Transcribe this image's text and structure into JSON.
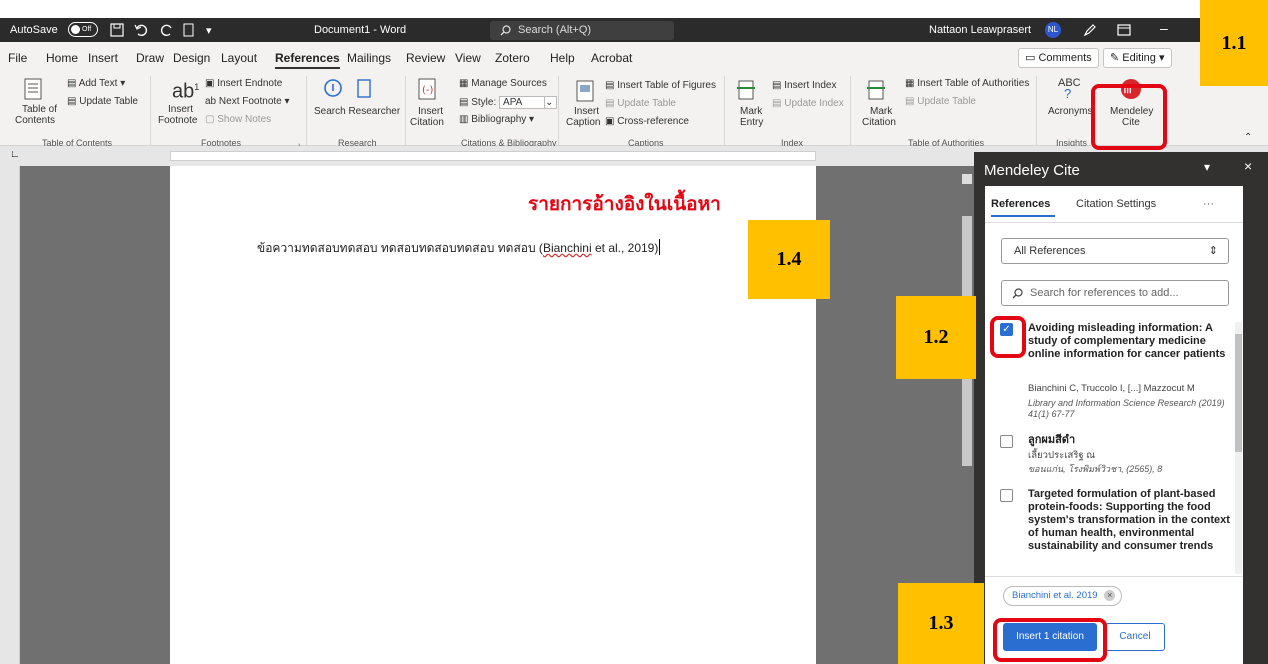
{
  "titlebar": {
    "autosave_label": "AutoSave",
    "autosave_state": "Off",
    "document_title": "Document1  -  Word",
    "search_placeholder": "Search (Alt+Q)",
    "user_name": "Nattaon Leawprasert",
    "user_initials": "NL"
  },
  "tabs": [
    "File",
    "Home",
    "Insert",
    "Draw",
    "Design",
    "Layout",
    "References",
    "Mailings",
    "Review",
    "View",
    "Zotero",
    "Help",
    "Acrobat"
  ],
  "active_tab": "References",
  "comments_label": "Comments",
  "editing_label": "Editing",
  "ribbon": {
    "toc": {
      "label1": "Table of",
      "label2": "Contents",
      "add_text": "Add Text",
      "update_table": "Update Table",
      "group": "Table of Contents"
    },
    "footnotes": {
      "label1": "Insert",
      "label2": "Footnote",
      "insert_endnote": "Insert Endnote",
      "next_footnote": "Next Footnote",
      "show_notes": "Show Notes",
      "group": "Footnotes"
    },
    "research": {
      "label": "Search Researcher",
      "group": "Research"
    },
    "citations": {
      "label1": "Insert",
      "label2": "Citation",
      "manage_sources": "Manage Sources",
      "style_label": "Style:",
      "style_value": "APA",
      "bibliography": "Bibliography",
      "group": "Citations & Bibliography"
    },
    "captions": {
      "label1": "Insert",
      "label2": "Caption",
      "insert_tof": "Insert Table of Figures",
      "update_table": "Update Table",
      "cross_reference": "Cross-reference",
      "group": "Captions"
    },
    "index": {
      "label1": "Mark",
      "label2": "Entry",
      "insert_index": "Insert Index",
      "update_index": "Update Index",
      "group": "Index"
    },
    "authorities": {
      "label1": "Mark",
      "label2": "Citation",
      "insert_toa": "Insert Table of Authorities",
      "update_table": "Update Table",
      "group": "Table of Authorities"
    },
    "insights": {
      "label": "Acronyms",
      "abc": "ABC",
      "group": "Insights"
    },
    "mendeley": {
      "label1": "Mendeley",
      "label2": "Cite"
    }
  },
  "document": {
    "heading": "รายการอ้างอิงในเนื้อหา",
    "body_text": "ข้อความทดสอบทดสอบ ทดสอบทดสอบทดสอบ ทดสอบ (",
    "citation_author": "Bianchini",
    "citation_rest": " et al., 2019)"
  },
  "annotations": {
    "label_1_1": "1.1",
    "label_1_2": "1.2",
    "label_1_3": "1.3",
    "label_1_4": "1.4"
  },
  "panel": {
    "title": "Mendeley Cite",
    "tab_references": "References",
    "tab_settings": "Citation Settings",
    "more": "···",
    "filter_value": "All References",
    "search_placeholder": "Search for references to add...",
    "references": [
      {
        "title": "Avoiding misleading information: A study of complementary medicine online information for cancer patients",
        "authors": "Bianchini C, Truccolo I, [...] Mazzocut M",
        "source": "Library and Information Science Research (2019) 41(1) 67-77",
        "checked": true
      },
      {
        "title": "ลูกผมสีดำ",
        "authors": "เลี้ยวประเสริฐ ณ",
        "source": "ขอนแก่น, โรงพิมพ์วิวชา, (2565), 8",
        "checked": false
      },
      {
        "title": "Targeted formulation of plant-based protein-foods: Supporting the food system's transformation in the context of human health, environmental sustainability and consumer trends",
        "authors": "",
        "source": "",
        "checked": false
      }
    ],
    "selected_chip": "Bianchini et al. 2019",
    "insert_button": "Insert 1 citation",
    "cancel_button": "Cancel"
  },
  "colors": {
    "annotation_fill": "#ffc000",
    "annotation_border": "#e30613",
    "accent_blue": "#2b6ed1",
    "heading_red": "#e30613"
  }
}
